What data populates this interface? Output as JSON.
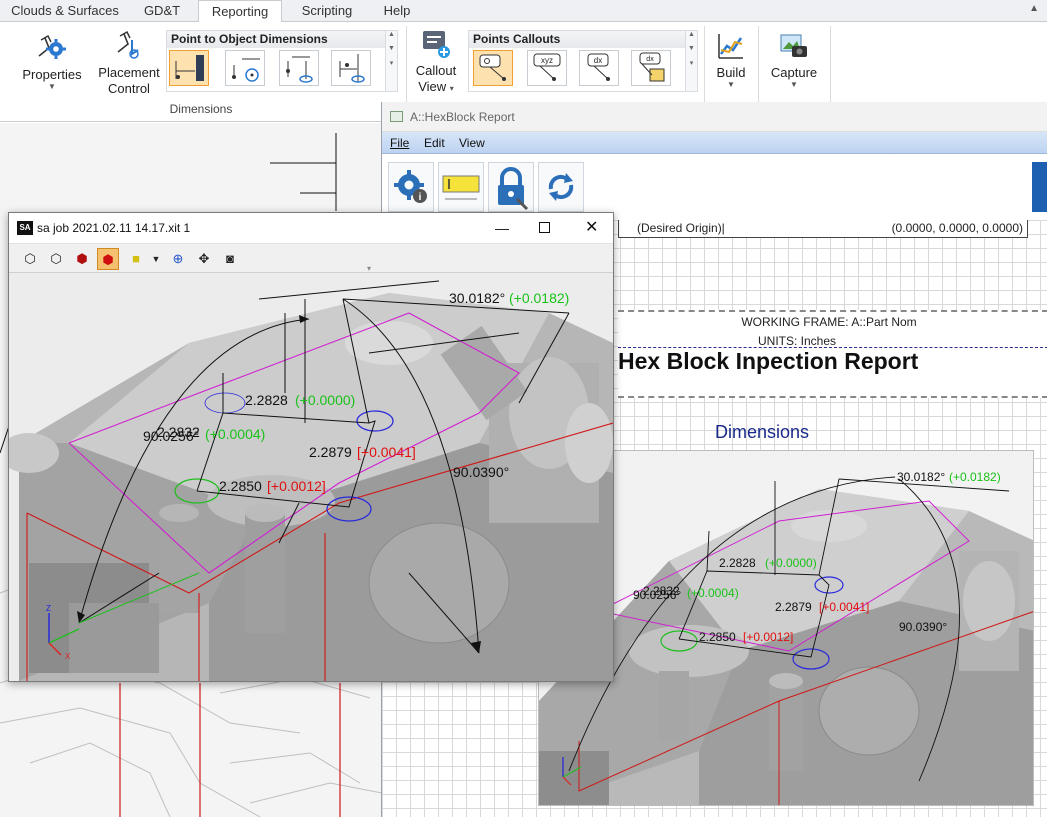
{
  "ribbon": {
    "tabs": [
      "Clouds & Surfaces",
      "GD&T",
      "Reporting",
      "Scripting",
      "Help"
    ],
    "active_tab": "Reporting",
    "properties_label": "Properties",
    "placement_label_1": "Placement",
    "placement_label_2": "Control",
    "p2o_group_title": "Point to Object Dimensions",
    "dimensions_group_label": "Dimensions",
    "callout_label_1": "Callout",
    "callout_label_2": "View",
    "points_callouts_title": "Points Callouts",
    "callout_xyz_text": "xyz",
    "callout_dx_text": "dx",
    "build_label": "Build",
    "capture_label": "Capture"
  },
  "report": {
    "title": "A::HexBlock Report",
    "menu": [
      "File",
      "Edit",
      "View"
    ],
    "origin_label": "(Desired Origin)|",
    "origin_value": "(0.0000, 0.0000, 0.0000)",
    "working_frame": "WORKING FRAME: A::Part Nom",
    "units": "UNITS: Inches",
    "heading": "Hex Block Inpection Report",
    "section_heading": "Dimensions"
  },
  "viewport": {
    "title": "sa job 2021.02.11 14.17.xit 1",
    "logo": "SA",
    "axis_z": "Z",
    "axis_x": "X"
  },
  "annotations": {
    "angle_top": "30.0182°",
    "angle_top_dev": "(+0.0182)",
    "angle_right": "90.0390°",
    "angle_left": "90.0256°",
    "dist_a": "2.2828",
    "dist_a_dev": "(+0.0000)",
    "dist_b": "2.2832",
    "dist_b_dev": "(+0.0004)",
    "dist_c": "2.2879",
    "dist_c_dev": "[+0.0041]",
    "dist_d": "2.2850",
    "dist_d_dev": "[+0.0012]"
  },
  "colors": {
    "ok_deviation": "#19c219",
    "out_deviation": "#e01010",
    "frame_magenta": "#d020d0",
    "frame_red": "#d01818",
    "ribbon_selected": "#fde2b0"
  }
}
